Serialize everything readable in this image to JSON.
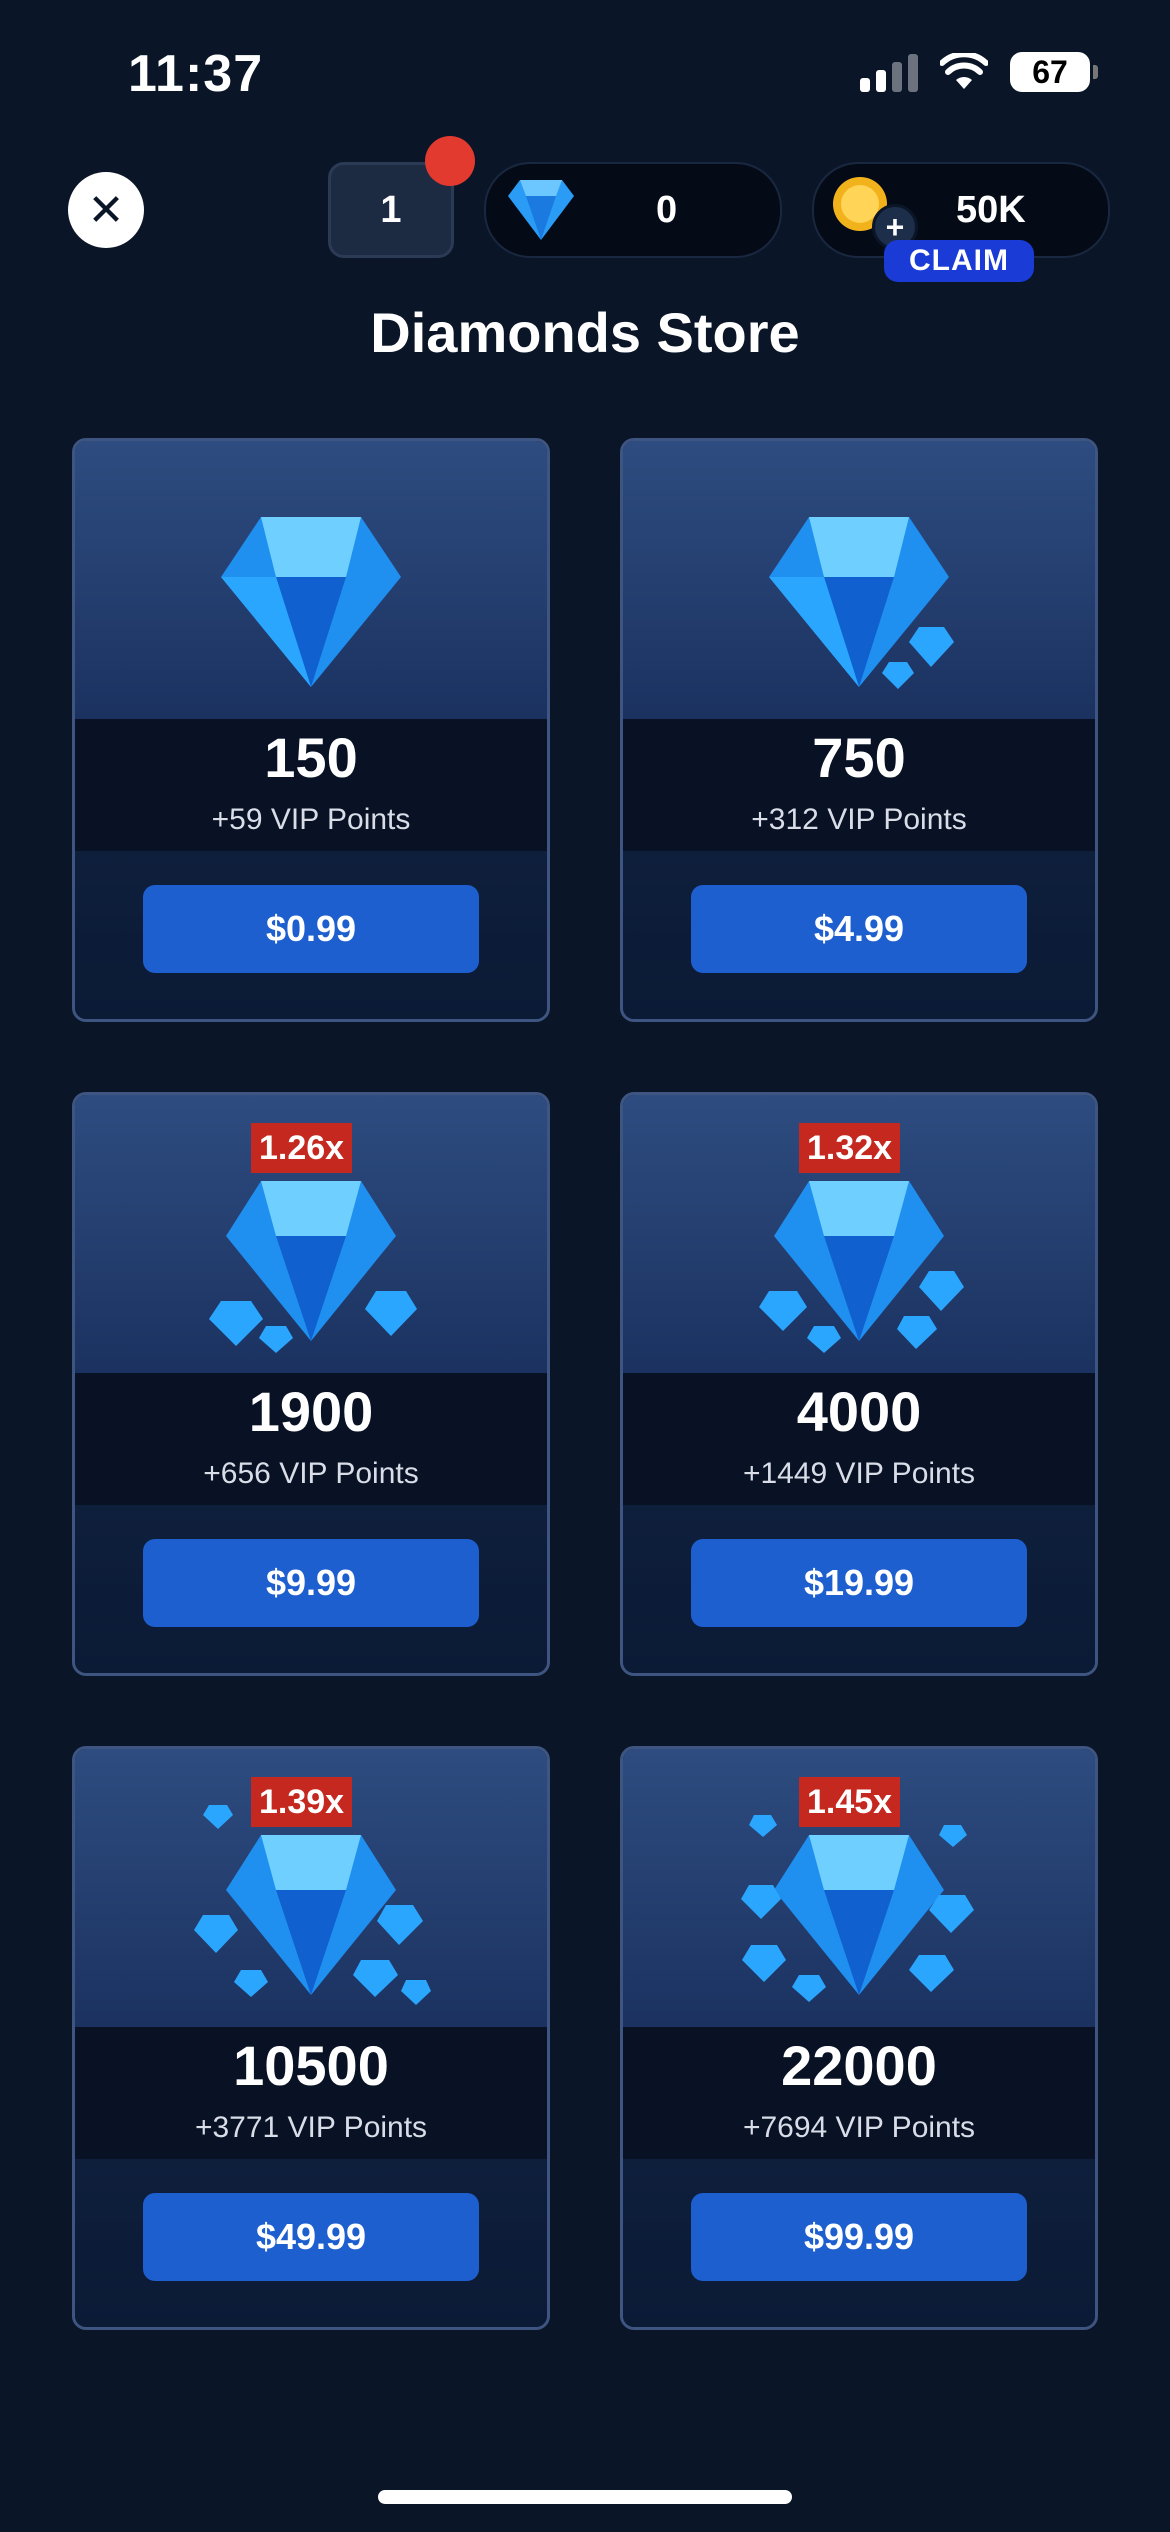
{
  "status_bar": {
    "time": "11:37",
    "battery": "67"
  },
  "header": {
    "level": "1",
    "diamonds": "0",
    "coins": "50K",
    "claim_label": "CLAIM"
  },
  "title": "Diamonds Store",
  "colors": {
    "background": "#0a1628",
    "button": "#1e5fd0",
    "multiplier": "#c4281f",
    "claim": "#1a3bd6"
  },
  "packs": [
    {
      "amount": "150",
      "vip": "+59 VIP Points",
      "price": "$0.99",
      "multiplier": ""
    },
    {
      "amount": "750",
      "vip": "+312 VIP Points",
      "price": "$4.99",
      "multiplier": ""
    },
    {
      "amount": "1900",
      "vip": "+656 VIP Points",
      "price": "$9.99",
      "multiplier": "1.26x"
    },
    {
      "amount": "4000",
      "vip": "+1449 VIP Points",
      "price": "$19.99",
      "multiplier": "1.32x"
    },
    {
      "amount": "10500",
      "vip": "+3771 VIP Points",
      "price": "$49.99",
      "multiplier": "1.39x"
    },
    {
      "amount": "22000",
      "vip": "+7694 VIP Points",
      "price": "$99.99",
      "multiplier": "1.45x"
    }
  ]
}
